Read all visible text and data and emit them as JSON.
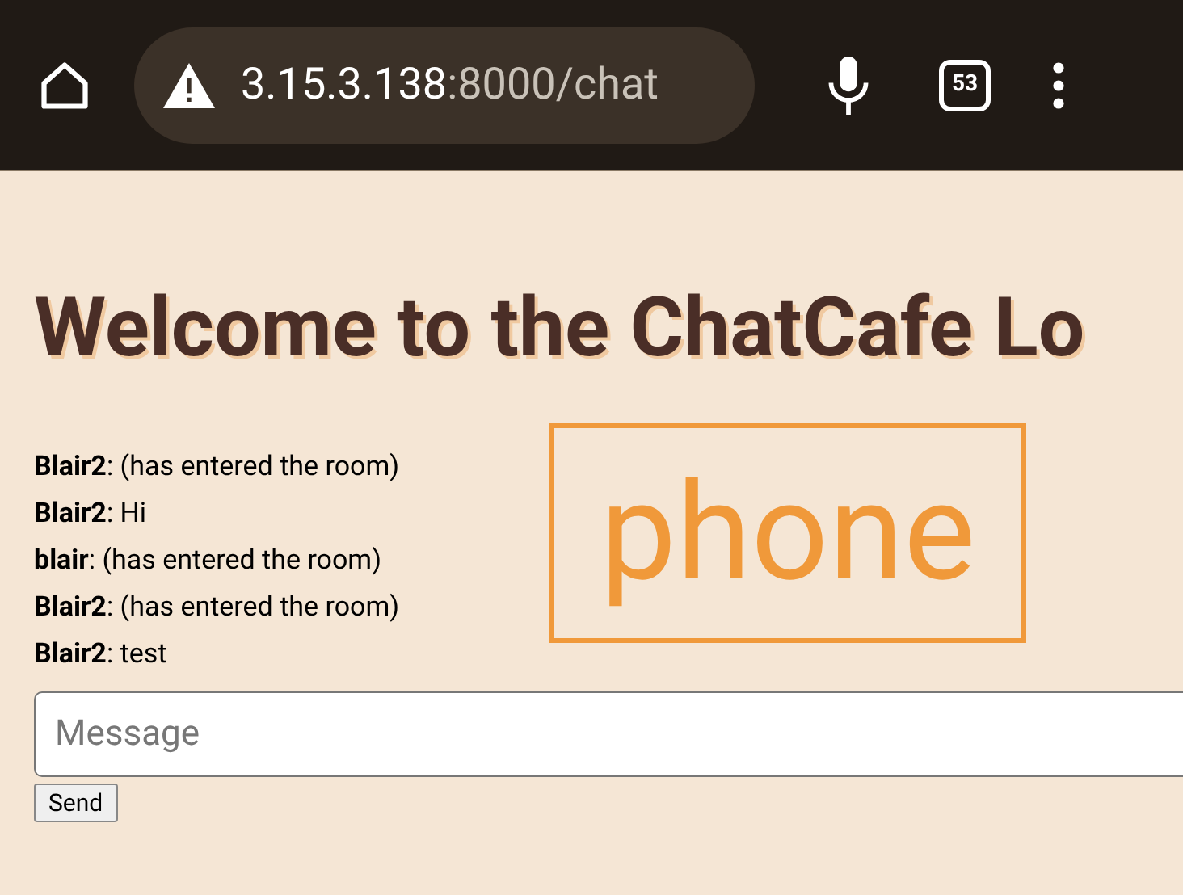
{
  "browser": {
    "url_host": "3.15.3.138",
    "url_path": ":8000/chat",
    "tab_count": "53"
  },
  "page": {
    "heading": "Welcome to the ChatCafe Lo",
    "messages": [
      {
        "user": "Blair2",
        "text": ": (has entered the room)"
      },
      {
        "user": "Blair2",
        "text": ": Hi"
      },
      {
        "user": "blair",
        "text": ": (has entered the room)"
      },
      {
        "user": "Blair2",
        "text": ": (has entered the room)"
      },
      {
        "user": "Blair2",
        "text": ": test"
      }
    ],
    "message_field": {
      "placeholder": "Message"
    },
    "send_button": "Send"
  },
  "annotation": {
    "label": "phone"
  }
}
